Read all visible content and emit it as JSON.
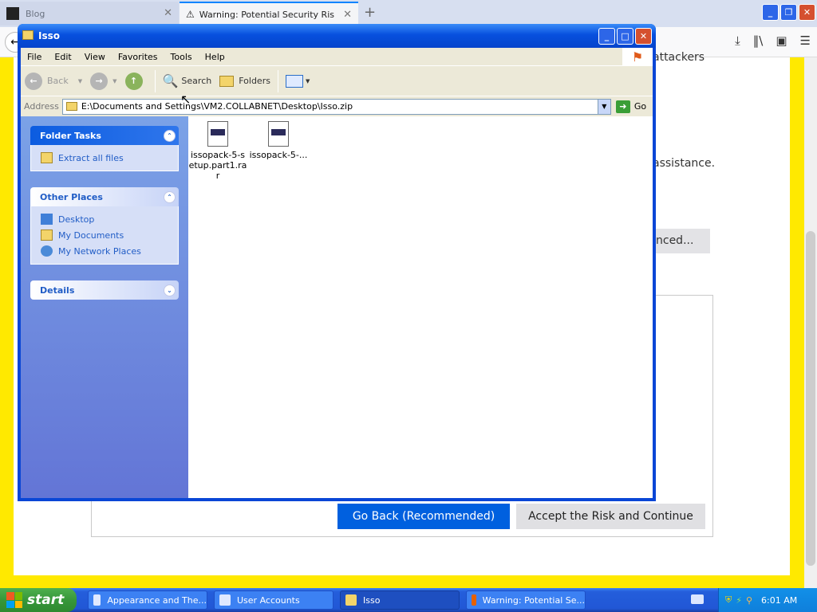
{
  "firefox": {
    "tabs": [
      {
        "title": "Blog",
        "active": false
      },
      {
        "title": "Warning: Potential Security Risk A",
        "active": true
      }
    ],
    "page": {
      "text1": "attackers",
      "text2": "assistance.",
      "advanced_label": "nced...",
      "go_back_label": "Go Back (Recommended)",
      "accept_label": "Accept the Risk and Continue"
    }
  },
  "explorer": {
    "title": "Isso",
    "menu": [
      "File",
      "Edit",
      "View",
      "Favorites",
      "Tools",
      "Help"
    ],
    "toolbar": {
      "back": "Back",
      "search": "Search",
      "folders": "Folders"
    },
    "address": {
      "label": "Address",
      "value": "E:\\Documents and Settings\\VM2.COLLABNET\\Desktop\\Isso.zip",
      "go": "Go"
    },
    "folder_tasks": {
      "title": "Folder Tasks",
      "items": [
        "Extract all files"
      ]
    },
    "other_places": {
      "title": "Other Places",
      "items": [
        "Desktop",
        "My Documents",
        "My Network Places"
      ]
    },
    "details": {
      "title": "Details"
    },
    "files": [
      {
        "name": "issopack-5-setup.part1.rar"
      },
      {
        "name": "issopack-5-..."
      }
    ]
  },
  "taskbar": {
    "start": "start",
    "tasks": [
      {
        "label": "Appearance and The...",
        "active": false
      },
      {
        "label": "User Accounts",
        "active": false
      },
      {
        "label": "Isso",
        "active": true
      },
      {
        "label": "Warning: Potential Se...",
        "active": false
      }
    ],
    "clock": "6:01 AM"
  },
  "colors": {
    "xp_blue": "#0a46d6",
    "firefox_primary": "#0060df",
    "warning_yellow": "#ffe900",
    "taskbar_blue": "#245edb"
  }
}
